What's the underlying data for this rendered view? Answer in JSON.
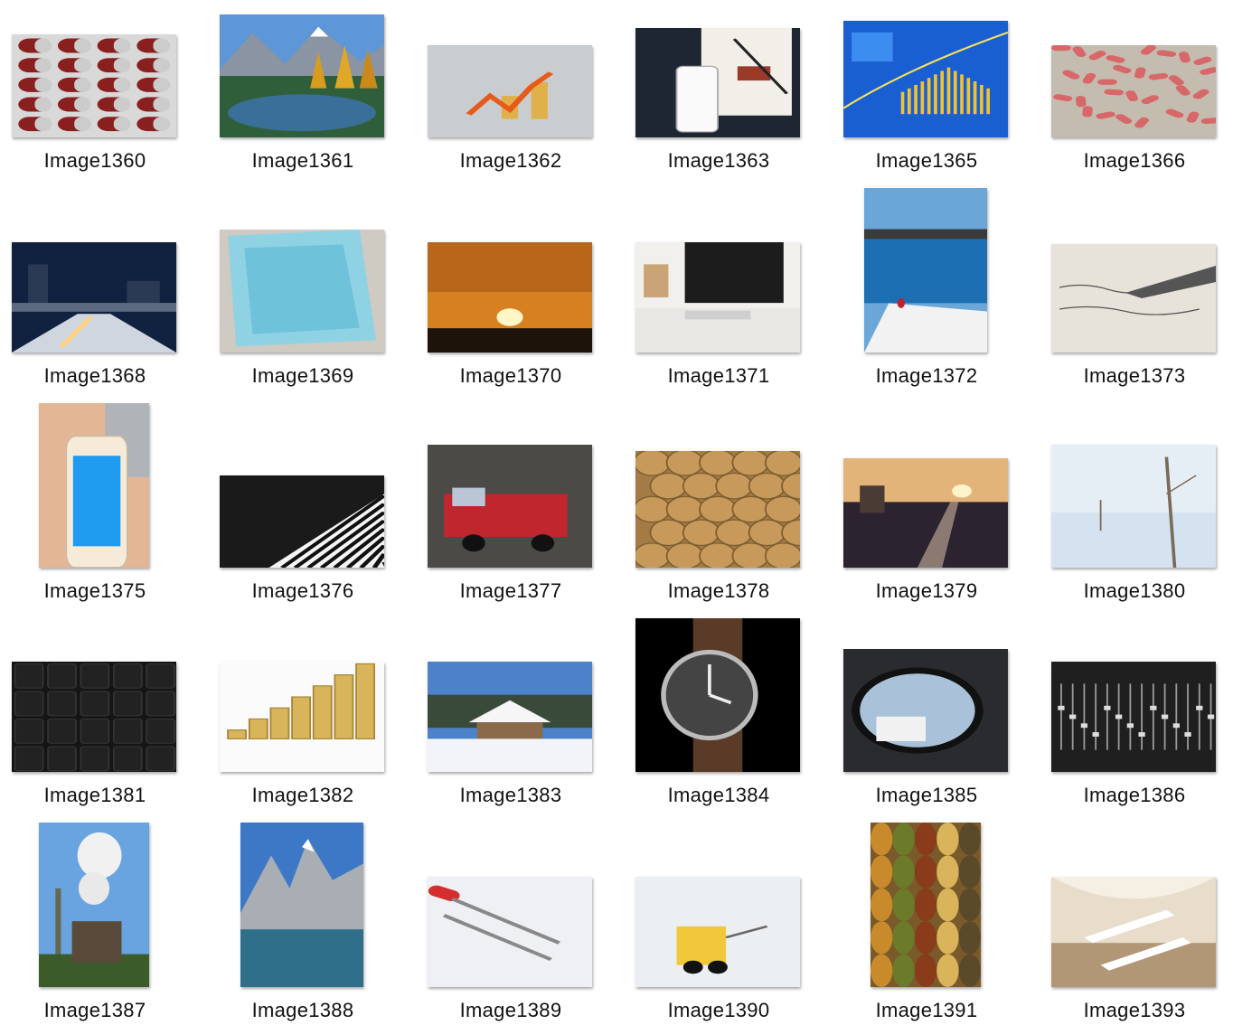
{
  "items": [
    {
      "label": "Image1360",
      "icon": "pills-blister-icon"
    },
    {
      "label": "Image1361",
      "icon": "mountain-lake-icon"
    },
    {
      "label": "Image1362",
      "icon": "growth-arrow-icon"
    },
    {
      "label": "Image1363",
      "icon": "phone-earbuds-icon"
    },
    {
      "label": "Image1365",
      "icon": "blue-chart-icon"
    },
    {
      "label": "Image1366",
      "icon": "red-pills-icon"
    },
    {
      "label": "Image1368",
      "icon": "night-city-bridge-icon"
    },
    {
      "label": "Image1369",
      "icon": "swimming-pool-icon"
    },
    {
      "label": "Image1370",
      "icon": "sunset-icon"
    },
    {
      "label": "Image1371",
      "icon": "desk-computer-icon"
    },
    {
      "label": "Image1372",
      "icon": "poolside-table-icon"
    },
    {
      "label": "Image1373",
      "icon": "fountain-pen-icon"
    },
    {
      "label": "Image1375",
      "icon": "smartphone-icon"
    },
    {
      "label": "Image1376",
      "icon": "piano-keys-icon"
    },
    {
      "label": "Image1377",
      "icon": "fire-truck-icon"
    },
    {
      "label": "Image1378",
      "icon": "coins-pile-icon"
    },
    {
      "label": "Image1379",
      "icon": "railway-sunset-icon"
    },
    {
      "label": "Image1380",
      "icon": "snow-branches-icon"
    },
    {
      "label": "Image1381",
      "icon": "keyboard-icon"
    },
    {
      "label": "Image1382",
      "icon": "coin-stacks-icon"
    },
    {
      "label": "Image1383",
      "icon": "snowy-house-icon"
    },
    {
      "label": "Image1384",
      "icon": "wristwatch-icon"
    },
    {
      "label": "Image1385",
      "icon": "side-mirror-icon"
    },
    {
      "label": "Image1386",
      "icon": "mixing-console-icon"
    },
    {
      "label": "Image1387",
      "icon": "factory-smoke-icon"
    },
    {
      "label": "Image1388",
      "icon": "mountain-peak-icon"
    },
    {
      "label": "Image1389",
      "icon": "screwdrivers-icon"
    },
    {
      "label": "Image1390",
      "icon": "robot-toy-icon"
    },
    {
      "label": "Image1391",
      "icon": "market-spices-icon"
    },
    {
      "label": "Image1393",
      "icon": "mall-interior-icon"
    }
  ]
}
